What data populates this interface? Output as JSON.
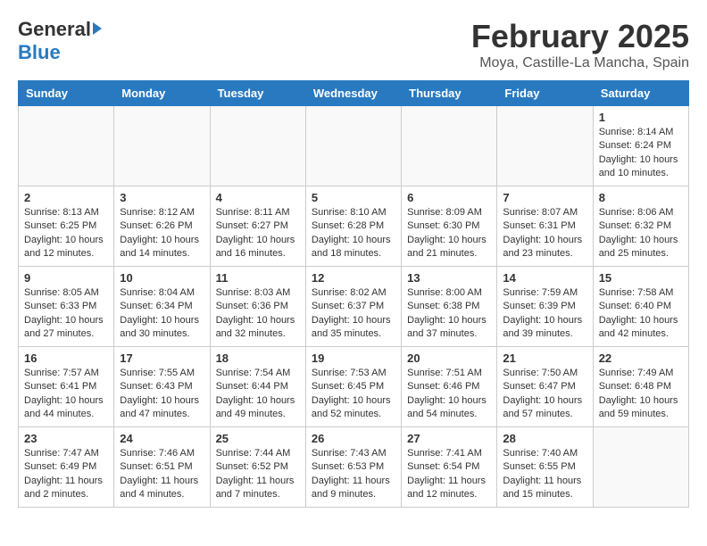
{
  "header": {
    "logo_general": "General",
    "logo_blue": "Blue",
    "month_title": "February 2025",
    "location": "Moya, Castille-La Mancha, Spain"
  },
  "weekdays": [
    "Sunday",
    "Monday",
    "Tuesday",
    "Wednesday",
    "Thursday",
    "Friday",
    "Saturday"
  ],
  "weeks": [
    [
      {
        "day": "",
        "info": ""
      },
      {
        "day": "",
        "info": ""
      },
      {
        "day": "",
        "info": ""
      },
      {
        "day": "",
        "info": ""
      },
      {
        "day": "",
        "info": ""
      },
      {
        "day": "",
        "info": ""
      },
      {
        "day": "1",
        "info": "Sunrise: 8:14 AM\nSunset: 6:24 PM\nDaylight: 10 hours\nand 10 minutes."
      }
    ],
    [
      {
        "day": "2",
        "info": "Sunrise: 8:13 AM\nSunset: 6:25 PM\nDaylight: 10 hours\nand 12 minutes."
      },
      {
        "day": "3",
        "info": "Sunrise: 8:12 AM\nSunset: 6:26 PM\nDaylight: 10 hours\nand 14 minutes."
      },
      {
        "day": "4",
        "info": "Sunrise: 8:11 AM\nSunset: 6:27 PM\nDaylight: 10 hours\nand 16 minutes."
      },
      {
        "day": "5",
        "info": "Sunrise: 8:10 AM\nSunset: 6:28 PM\nDaylight: 10 hours\nand 18 minutes."
      },
      {
        "day": "6",
        "info": "Sunrise: 8:09 AM\nSunset: 6:30 PM\nDaylight: 10 hours\nand 21 minutes."
      },
      {
        "day": "7",
        "info": "Sunrise: 8:07 AM\nSunset: 6:31 PM\nDaylight: 10 hours\nand 23 minutes."
      },
      {
        "day": "8",
        "info": "Sunrise: 8:06 AM\nSunset: 6:32 PM\nDaylight: 10 hours\nand 25 minutes."
      }
    ],
    [
      {
        "day": "9",
        "info": "Sunrise: 8:05 AM\nSunset: 6:33 PM\nDaylight: 10 hours\nand 27 minutes."
      },
      {
        "day": "10",
        "info": "Sunrise: 8:04 AM\nSunset: 6:34 PM\nDaylight: 10 hours\nand 30 minutes."
      },
      {
        "day": "11",
        "info": "Sunrise: 8:03 AM\nSunset: 6:36 PM\nDaylight: 10 hours\nand 32 minutes."
      },
      {
        "day": "12",
        "info": "Sunrise: 8:02 AM\nSunset: 6:37 PM\nDaylight: 10 hours\nand 35 minutes."
      },
      {
        "day": "13",
        "info": "Sunrise: 8:00 AM\nSunset: 6:38 PM\nDaylight: 10 hours\nand 37 minutes."
      },
      {
        "day": "14",
        "info": "Sunrise: 7:59 AM\nSunset: 6:39 PM\nDaylight: 10 hours\nand 39 minutes."
      },
      {
        "day": "15",
        "info": "Sunrise: 7:58 AM\nSunset: 6:40 PM\nDaylight: 10 hours\nand 42 minutes."
      }
    ],
    [
      {
        "day": "16",
        "info": "Sunrise: 7:57 AM\nSunset: 6:41 PM\nDaylight: 10 hours\nand 44 minutes."
      },
      {
        "day": "17",
        "info": "Sunrise: 7:55 AM\nSunset: 6:43 PM\nDaylight: 10 hours\nand 47 minutes."
      },
      {
        "day": "18",
        "info": "Sunrise: 7:54 AM\nSunset: 6:44 PM\nDaylight: 10 hours\nand 49 minutes."
      },
      {
        "day": "19",
        "info": "Sunrise: 7:53 AM\nSunset: 6:45 PM\nDaylight: 10 hours\nand 52 minutes."
      },
      {
        "day": "20",
        "info": "Sunrise: 7:51 AM\nSunset: 6:46 PM\nDaylight: 10 hours\nand 54 minutes."
      },
      {
        "day": "21",
        "info": "Sunrise: 7:50 AM\nSunset: 6:47 PM\nDaylight: 10 hours\nand 57 minutes."
      },
      {
        "day": "22",
        "info": "Sunrise: 7:49 AM\nSunset: 6:48 PM\nDaylight: 10 hours\nand 59 minutes."
      }
    ],
    [
      {
        "day": "23",
        "info": "Sunrise: 7:47 AM\nSunset: 6:49 PM\nDaylight: 11 hours\nand 2 minutes."
      },
      {
        "day": "24",
        "info": "Sunrise: 7:46 AM\nSunset: 6:51 PM\nDaylight: 11 hours\nand 4 minutes."
      },
      {
        "day": "25",
        "info": "Sunrise: 7:44 AM\nSunset: 6:52 PM\nDaylight: 11 hours\nand 7 minutes."
      },
      {
        "day": "26",
        "info": "Sunrise: 7:43 AM\nSunset: 6:53 PM\nDaylight: 11 hours\nand 9 minutes."
      },
      {
        "day": "27",
        "info": "Sunrise: 7:41 AM\nSunset: 6:54 PM\nDaylight: 11 hours\nand 12 minutes."
      },
      {
        "day": "28",
        "info": "Sunrise: 7:40 AM\nSunset: 6:55 PM\nDaylight: 11 hours\nand 15 minutes."
      },
      {
        "day": "",
        "info": ""
      }
    ]
  ]
}
